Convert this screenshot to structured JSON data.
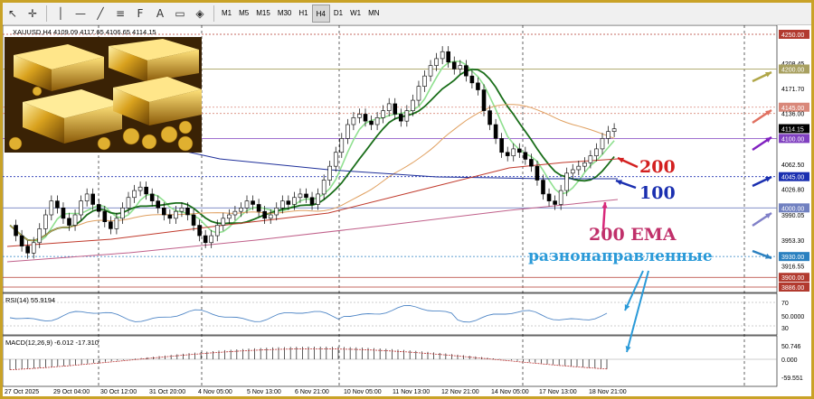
{
  "toolbar": {
    "icons": [
      "cursor-icon",
      "crosshair-icon",
      "vertical-line-icon",
      "horizontal-line-icon",
      "trendline-icon",
      "channel-icon",
      "fibonacci-icon",
      "text-icon",
      "label-icon",
      "shapes-icon"
    ],
    "timeframes": [
      "M1",
      "M5",
      "M15",
      "M30",
      "H1",
      "H4",
      "D1",
      "W1",
      "MN"
    ],
    "active_timeframe": "H4"
  },
  "symbol_line": "XAUUSD,H4  4109.09 4117.65 4106.65 4114.15",
  "annotations": {
    "a200": "200",
    "a100": "100",
    "ema": "200 EMA",
    "divergent": "разнонаправленные"
  },
  "indicators": {
    "rsi_label": "RSI(14) 55.9194",
    "macd_label": "MACD(12,26,9) -6.012 -17.310"
  },
  "price_axis": {
    "labels": [
      "4250.00",
      "4208.45",
      "4200.00",
      "4171.70",
      "4145.00",
      "4136.00",
      "4114.15",
      "4100.00",
      "4062.50",
      "4045.00",
      "4026.80",
      "4000.00",
      "3990.05",
      "3953.30",
      "3930.00",
      "3916.55",
      "3900.00",
      "3886.00"
    ],
    "rsi": [
      "70",
      "50.0000",
      "30"
    ],
    "macd": [
      "50.746",
      "0.000",
      "-59.551"
    ]
  },
  "time_axis": [
    "27 Oct 2025",
    "29 Oct 04:00",
    "30 Oct 12:00",
    "31 Oct 20:00",
    "4 Nov 05:00",
    "5 Nov 13:00",
    "6 Nov 21:00",
    "10 Nov 05:00",
    "11 Nov 13:00",
    "12 Nov 21:00",
    "14 Nov 05:00",
    "17 Nov 13:00",
    "18 Nov 21:00"
  ],
  "colors": {
    "frame": "#c9a227",
    "bull": "#ffffff",
    "candle_outline": "#000000",
    "ema_fast": "#90e090",
    "ema_slow": "#1a6e1a",
    "ma100": "#1e2f9a",
    "ma200": "#c0392b",
    "ema200": "#c0608a",
    "orange_ma": "#e0a060",
    "rsi": "#4f86c6",
    "macd": "#b33"
  }
}
